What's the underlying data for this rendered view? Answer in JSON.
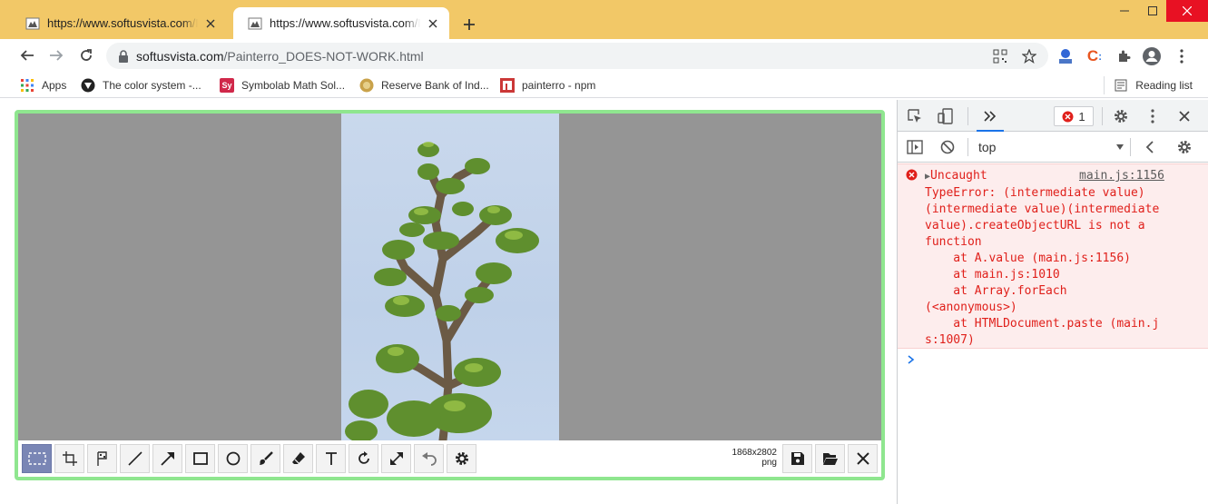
{
  "tabs": [
    {
      "title": "https://www.softusvista.com/Painterro_DOES-NOT-WORK.html"
    },
    {
      "title": "https://www.softusvista.com/Painterro_DOES-NOT-WORK.html"
    }
  ],
  "address": {
    "host": "softusvista.com",
    "path": "/Painterro_DOES-NOT-WORK.html"
  },
  "bookmarks": [
    {
      "label": "Apps"
    },
    {
      "label": "The color system -..."
    },
    {
      "label": "Symbolab Math Sol..."
    },
    {
      "label": "Reserve Bank of Ind..."
    },
    {
      "label": "painterro - npm"
    }
  ],
  "bookmark_icon_text": {
    "symbolab": "Sy"
  },
  "reading_list": "Reading list",
  "extension_icon_text": {
    "c": "C"
  },
  "painterro": {
    "size": "1868x2802",
    "format": "png",
    "tools": [
      "select",
      "crop",
      "pixelize",
      "line",
      "arrow",
      "rect",
      "ellipse",
      "brush",
      "eraser",
      "text",
      "rotate",
      "resize",
      "undo",
      "settings",
      "save",
      "open",
      "close"
    ]
  },
  "devtools": {
    "error_count": "1",
    "context": "top",
    "error_lines": [
      "Uncaught",
      "TypeError: (intermediate value)",
      "(intermediate value)(intermediate",
      "value).createObjectURL is not a",
      "function",
      "    at A.value (main.js:1156)",
      "    at main.js:1010",
      "    at Array.forEach",
      "(<anonymous>)",
      "    at HTMLDocument.paste (main.j",
      "s:1007)"
    ],
    "error_source": "main.js:1156"
  },
  "colors": {
    "tab_strip": "#f2c867",
    "painterro_border": "#8fe68f",
    "error_red": "#e0201b",
    "error_bg": "#fdeded",
    "active_tool": "#7a86b5"
  }
}
